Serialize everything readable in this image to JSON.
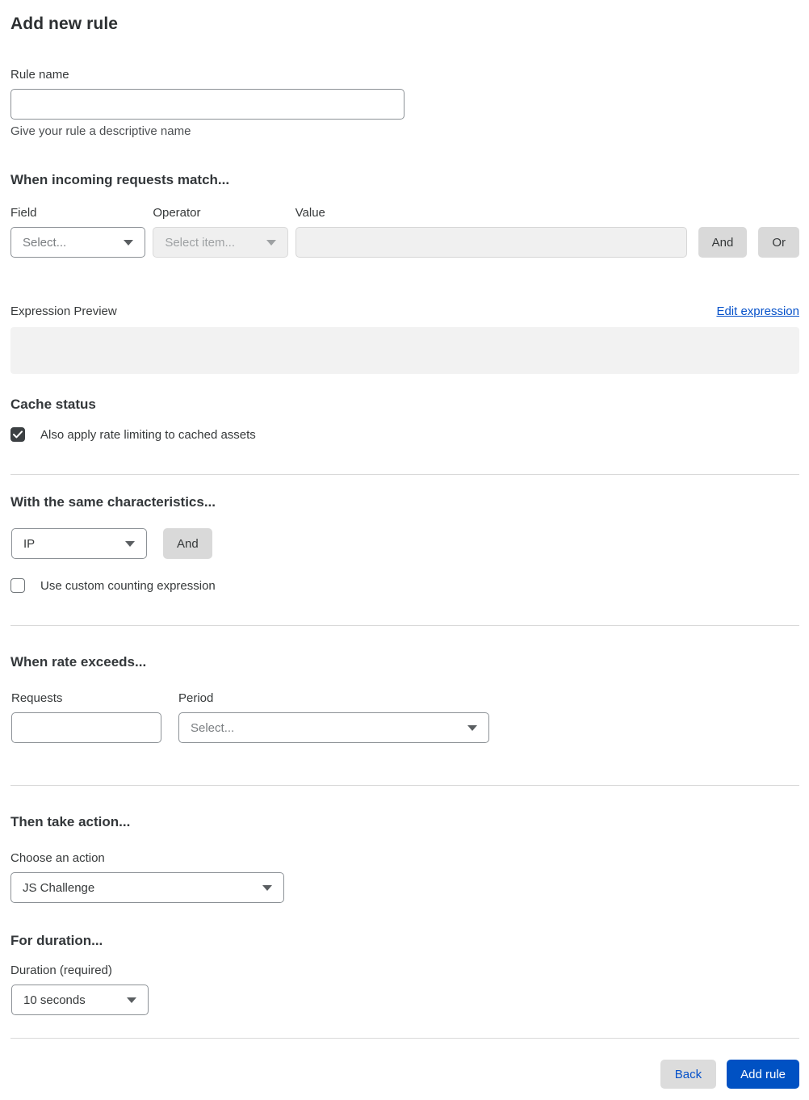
{
  "page": {
    "title": "Add new rule"
  },
  "rule_name": {
    "label": "Rule name",
    "value": "",
    "helper": "Give your rule a descriptive name"
  },
  "match_section": {
    "heading": "When incoming requests match...",
    "field": {
      "label": "Field",
      "selected": "Select..."
    },
    "operator": {
      "label": "Operator",
      "selected": "Select item...",
      "disabled": true
    },
    "value": {
      "label": "Value",
      "value": "",
      "disabled": true
    },
    "and_button": "And",
    "or_button": "Or",
    "expression_preview_label": "Expression Preview",
    "edit_expression_link": "Edit expression",
    "expression_preview_value": ""
  },
  "cache_status": {
    "heading": "Cache status",
    "checkbox_label": "Also apply rate limiting to cached assets",
    "checked": true
  },
  "characteristics": {
    "heading": "With the same characteristics...",
    "selected": "IP",
    "and_button": "And",
    "checkbox_label": "Use custom counting expression",
    "checked": false
  },
  "rate": {
    "heading": "When rate exceeds...",
    "requests_label": "Requests",
    "requests_value": "",
    "period_label": "Period",
    "period_selected": "Select..."
  },
  "action": {
    "heading": "Then take action...",
    "label": "Choose an action",
    "selected": "JS Challenge"
  },
  "duration": {
    "heading": "For duration...",
    "label": "Duration (required)",
    "selected": "10 seconds"
  },
  "footer": {
    "back_button": "Back",
    "add_rule_button": "Add rule"
  },
  "colors": {
    "accent_blue": "#0051c3",
    "link_blue": "#0551ca",
    "heading_text": "#36393a",
    "disabled_bg": "#f0f0f0",
    "button_gray": "#d9d9d9",
    "checkbox_checked": "#3c4043"
  },
  "icons": {
    "chevron_down": "caret-down",
    "checkmark": "check"
  }
}
